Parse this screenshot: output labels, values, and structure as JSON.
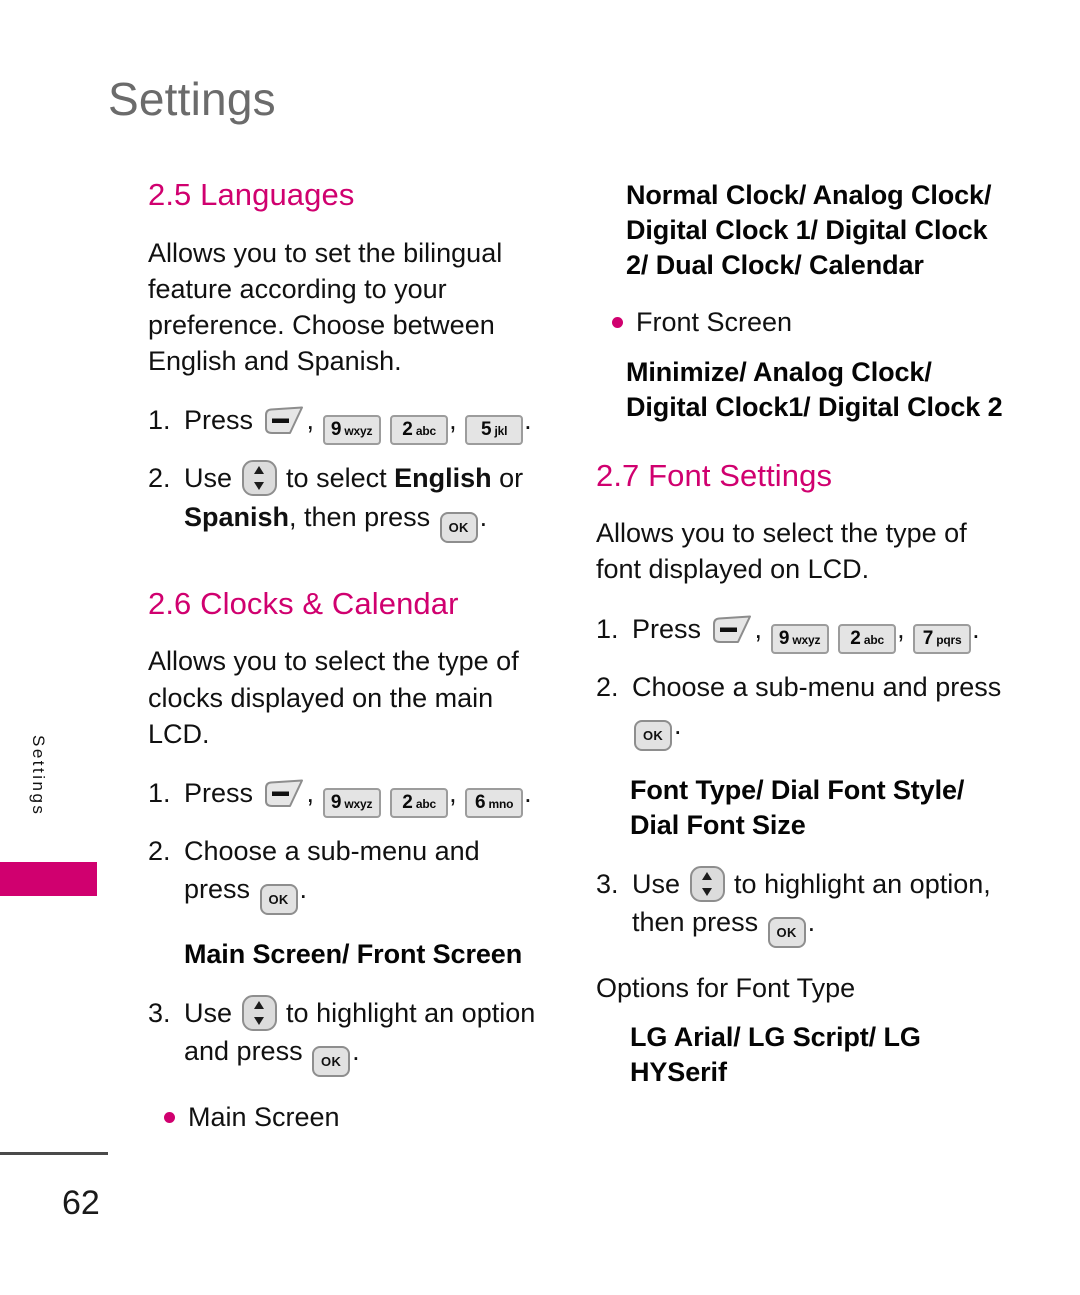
{
  "page": {
    "chapter_title": "Settings",
    "side_tab_label": "Settings",
    "page_number": "62",
    "accent_color": "#d0006f",
    "title_color": "#6b6b6b"
  },
  "keys": {
    "menu": "menu-key",
    "ok": "OK",
    "nav": "navigation-key",
    "k9": {
      "digit": "9",
      "letters": "wxyz"
    },
    "k2": {
      "digit": "2",
      "letters": "abc"
    },
    "k5": {
      "digit": "5",
      "letters": "jkl"
    },
    "k6": {
      "digit": "6",
      "letters": "mno"
    },
    "k7": {
      "digit": "7",
      "letters": "pqrs"
    }
  },
  "left_column": {
    "section_2_5": {
      "heading": "2.5 Languages",
      "intro": "Allows you to set the bilingual feature according to your preference. Choose between English and Spanish.",
      "step1": {
        "num": "1.",
        "pre": "Press",
        "sep1": ",",
        "sep2": ",",
        "end": "."
      },
      "step2": {
        "num": "2.",
        "pre": "Use",
        "mid": "to select",
        "option1": "English",
        "conj": "or",
        "option2": "Spanish",
        "post": ", then press",
        "end": "."
      }
    },
    "section_2_6": {
      "heading": "2.6 Clocks & Calendar",
      "intro": "Allows you to select the type of clocks displayed on the main LCD.",
      "step1": {
        "num": "1.",
        "pre": "Press",
        "sep1": ",",
        "sep2": ",",
        "end": "."
      },
      "step2": {
        "num": "2.",
        "text": "Choose a sub-menu and press",
        "end": "."
      },
      "options_line": "Main Screen/ Front Screen",
      "step3": {
        "num": "3.",
        "pre": "Use",
        "mid": "to highlight an option and press",
        "end": "."
      },
      "bullets": [
        "Main Screen"
      ]
    }
  },
  "right_column": {
    "clock_options": "Normal Clock/ Analog Clock/ Digital Clock 1/ Digital Clock 2/ Dual Clock/ Calendar",
    "bullets": [
      "Front Screen"
    ],
    "front_screen_options": "Minimize/ Analog Clock/ Digital Clock1/ Digital Clock 2",
    "section_2_7": {
      "heading": "2.7 Font Settings",
      "intro": "Allows you to select the type of font displayed on LCD.",
      "step1": {
        "num": "1.",
        "pre": "Press",
        "sep1": ",",
        "sep2": ",",
        "end": "."
      },
      "step2": {
        "num": "2.",
        "text": "Choose a sub-menu and press",
        "end": "."
      },
      "options_line": "Font Type/ Dial Font Style/ Dial Font Size",
      "step3": {
        "num": "3.",
        "pre": "Use",
        "mid": "to highlight an option, then press",
        "end": "."
      },
      "options_label": "Options for Font Type",
      "font_options": "LG Arial/ LG Script/ LG HYSerif"
    }
  }
}
